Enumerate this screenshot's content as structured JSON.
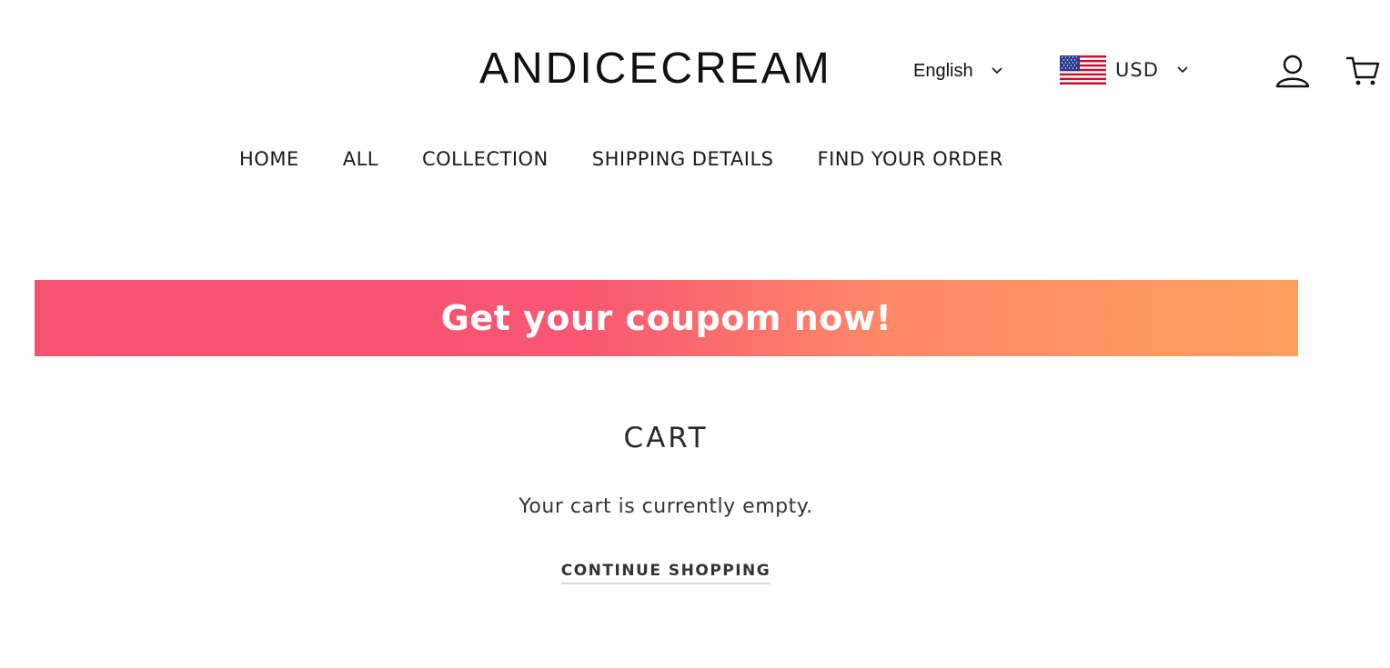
{
  "header": {
    "logo": "ANDICECREAM",
    "language": {
      "selected": "English",
      "icon": "chevron-down-icon"
    },
    "currency": {
      "selected": "USD",
      "flag": "us-flag-icon",
      "icon": "chevron-down-icon"
    },
    "icons": [
      "account-icon",
      "cart-icon"
    ]
  },
  "nav": {
    "items": [
      "HOME",
      "ALL",
      "COLLECTION",
      "SHIPPING DETAILS",
      "FIND YOUR ORDER"
    ]
  },
  "banner": {
    "text": "Get your coupom now!",
    "colors": {
      "start": "#f85071",
      "end": "#ff9f5e"
    }
  },
  "cart": {
    "title": "CART",
    "empty_message": "Your cart is currently empty.",
    "continue_label": "CONTINUE SHOPPING"
  }
}
